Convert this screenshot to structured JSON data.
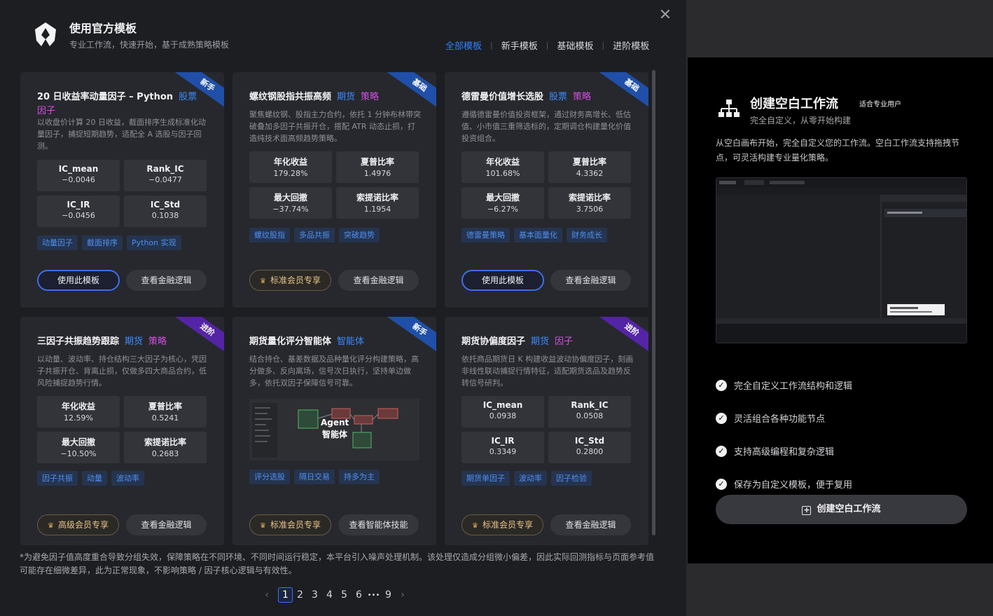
{
  "header": {
    "title": "使用官方模板",
    "subtitle": "专业工作流，快速开始，基于成熟策略模板",
    "close_glyph": "✕",
    "tabs": [
      "全部模板",
      "新手模板",
      "基础模板",
      "进阶模板"
    ],
    "active_tab": "全部模板"
  },
  "cards": [
    {
      "ribbon": "新手",
      "title": "20 日收益率动量因子 – Python",
      "tag1": "股票",
      "tag2": "因子",
      "desc": "以收盘价计算 20 日收益，截面排序生成标准化动量因子，捕捉短期趋势，适配全 A 选股与因子回测。",
      "metrics": [
        [
          "IC_mean",
          "−0.0046"
        ],
        [
          "Rank_IC",
          "−0.0477"
        ],
        [
          "IC_IR",
          "−0.0456"
        ],
        [
          "IC_Std",
          "0.1038"
        ]
      ],
      "chips": [
        "动量因子",
        "截面排序",
        "Python 实现"
      ],
      "btn1": "使用此模板",
      "btn2": "查看金融逻辑"
    },
    {
      "ribbon": "基础",
      "title": "螺纹钢股指共振高频",
      "tag1": "期货",
      "tag2": "策略",
      "desc": "聚焦螺纹钢、股指主力合约，依托 1 分钟布林带突破叠加多因子共振开仓，搭配 ATR 动态止损，打造纯技术面高频趋势策略。",
      "metrics": [
        [
          "年化收益",
          "179.28%"
        ],
        [
          "夏普比率",
          "1.4976"
        ],
        [
          "最大回撤",
          "−37.74%"
        ],
        [
          "索提诺比率",
          "1.1954"
        ]
      ],
      "chips": [
        "螺纹股指",
        "多品共振",
        "突破趋势"
      ],
      "btn1": "标准会员专享",
      "btn2": "查看金融逻辑"
    },
    {
      "ribbon": "基础",
      "title": "德雷曼价值增长选股",
      "tag1": "股票",
      "tag2": "策略",
      "desc": "遵循德雷曼价值投资框架，通过财务高增长、低估值、小市值三重筛选标的，定期调仓构建量化价值投资组合。",
      "metrics": [
        [
          "年化收益",
          "101.68%"
        ],
        [
          "夏普比率",
          "4.3362"
        ],
        [
          "最大回撤",
          "−6.27%"
        ],
        [
          "索提诺比率",
          "3.7506"
        ]
      ],
      "chips": [
        "德雷曼策略",
        "基本面量化",
        "财务成长"
      ],
      "btn1": "使用此模板",
      "btn2": "查看金融逻辑"
    },
    {
      "ribbon": "进阶",
      "title": "三因子共振趋势跟踪",
      "tag1": "期货",
      "tag2": "策略",
      "desc": "以动量、波动率、持仓结构三大因子为核心，凭因子共振开仓、背离止损，仅做多四大商品合约，低风险捕捉趋势行情。",
      "metrics": [
        [
          "年化收益",
          "12.59%"
        ],
        [
          "夏普比率",
          "0.5241"
        ],
        [
          "最大回撤",
          "−10.50%"
        ],
        [
          "索提诺比率",
          "0.2683"
        ]
      ],
      "chips": [
        "因子共振",
        "动量",
        "波动率"
      ],
      "btn1": "高级会员专享",
      "btn2": "查看金融逻辑"
    },
    {
      "ribbon": "新手",
      "title": "期货量化评分智能体",
      "tag1": "智能体",
      "tag2": "",
      "desc": "结合持仓、基差数据及品种量化评分构建策略，高分做多、反向离场，信号次日执行，坚持单边做多，依托双因子保障信号可靠。",
      "image_label_1": "Agent",
      "image_label_2": "智能体",
      "chips": [
        "评分选股",
        "隔日交易",
        "持多为主"
      ],
      "btn1": "标准会员专享",
      "btn2": "查看智能体技能"
    },
    {
      "ribbon": "进阶",
      "title": "期货协偏度因子",
      "tag1": "期货",
      "tag2": "因子",
      "desc": "依托商品期货日 K 构建收益波动协偏度因子，刻画非线性联动捕捉行情特征，适配期货选品及趋势反转信号研判。",
      "metrics": [
        [
          "IC_mean",
          "0.0938"
        ],
        [
          "Rank_IC",
          "0.0508"
        ],
        [
          "IC_IR",
          "0.3349"
        ],
        [
          "IC_Std",
          "0.2800"
        ]
      ],
      "chips": [
        "期货单因子",
        "波动率",
        "因子检验"
      ],
      "btn1": "标准会员专享",
      "btn2": "查看金融逻辑"
    }
  ],
  "footnote": "*为避免因子值高度重合导致分组失效，保障策略在不同环境、不同时间运行稳定，本平台引入噪声处理机制。该处理仅造成分组微小偏差，因此实际回测指标与页面参考值可能存在细微差异，此为正常现象，不影响策略 / 因子核心逻辑与有效性。",
  "pager": {
    "prev": "‹",
    "pages": [
      "1",
      "2",
      "3",
      "4",
      "5",
      "6",
      "•••",
      "9"
    ],
    "current": "1",
    "next": "›"
  },
  "right": {
    "title": "创建空白工作流",
    "badge": "适合专业用户",
    "subtitle": "完全自定义，从零开始构建",
    "desc": "从空白画布开始，完全自定义您的工作流。空白工作流支持拖拽节点，可灵活构建专业量化策略。",
    "features": [
      "完全自定义工作流结构和逻辑",
      "灵活组合各种功能节点",
      "支持高级编程和复杂逻辑",
      "保存为自定义模板，便于复用"
    ],
    "check_glyph": "✓",
    "button": "创建空白工作流"
  },
  "colors": {
    "accent": "#2f80ff",
    "ribbon_blue": "#1f4fa8",
    "ribbon_purple": "#5424a6",
    "tag_purple": "#d04fe0",
    "member_gold": "#e8c38a"
  }
}
